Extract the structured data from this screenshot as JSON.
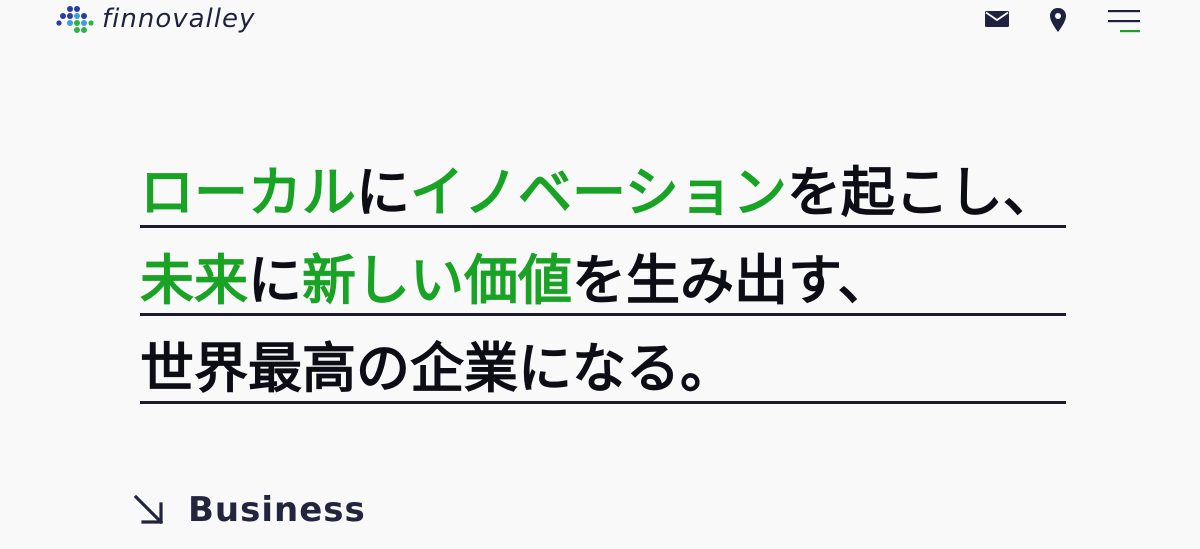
{
  "header": {
    "logo_text": "finnovalley",
    "mail_icon": "mail-icon",
    "location_icon": "map-pin-icon",
    "menu_icon": "hamburger-menu-icon"
  },
  "hero": {
    "lines": [
      [
        {
          "text": "ローカル",
          "color": "green"
        },
        {
          "text": "に",
          "color": "black"
        },
        {
          "text": "イノベーション",
          "color": "green"
        },
        {
          "text": "を起こし、",
          "color": "black"
        }
      ],
      [
        {
          "text": "未来",
          "color": "green"
        },
        {
          "text": "に",
          "color": "black"
        },
        {
          "text": "新しい価値",
          "color": "green"
        },
        {
          "text": "を生み出す、",
          "color": "black"
        }
      ],
      [
        {
          "text": "世界最高の企業になる。",
          "color": "black"
        }
      ]
    ]
  },
  "business": {
    "label": "Business",
    "icon": "arrow-down-right-icon"
  },
  "colors": {
    "accent_green": "#18a325",
    "text_dark": "#0d0d16",
    "navy": "#1e2140",
    "background": "#f9f9f9"
  }
}
